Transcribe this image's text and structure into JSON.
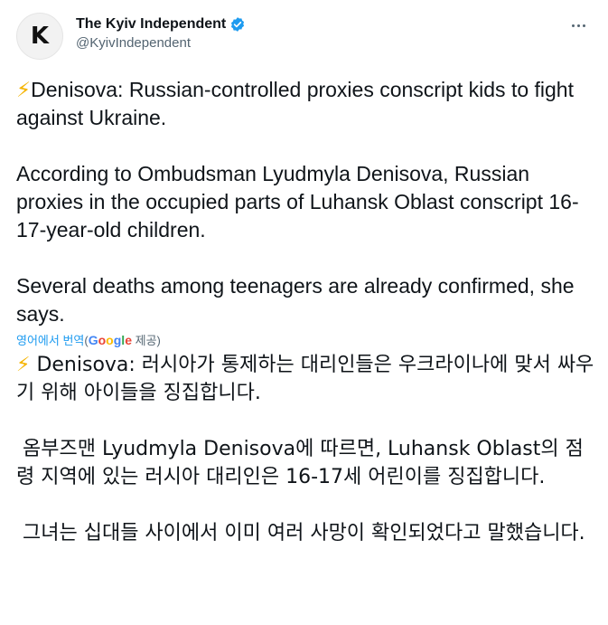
{
  "account": {
    "avatar_letter": "K",
    "display_name": "The Kyiv Independent",
    "handle": "@KyivIndependent",
    "verified": true,
    "verified_color": "#1d9bf0"
  },
  "menu": {
    "icon": "more-horizontal-icon"
  },
  "tweet": {
    "bolt": "⚡",
    "text_after_bolt": "Denisova: Russian-controlled proxies conscript kids to fight against Ukraine.\n\nAccording to Ombudsman Lyudmyla Denisova, Russian proxies in the occupied parts of Luhansk Oblast conscript 16-17-year-old children.\n\nSeveral deaths among teenagers are already confirmed, she says."
  },
  "translation": {
    "link_label": "영어에서 번역",
    "open_paren": "(",
    "google_g1": "G",
    "google_o1": "o",
    "google_o2": "o",
    "google_g2": "g",
    "google_l": "l",
    "google_e": "e",
    "provided_label": "제공)",
    "text_after_bolt": " Denisova: 러시아가 통제하는 대리인들은 우크라이나에 맞서 싸우기 위해 아이들을 징집합니다.\n\n 옴부즈맨 Lyudmyla Denisova에 따르면, Luhansk Oblast의 점령 지역에 있는 러시아 대리인은 16-17세 어린이를 징집합니다.\n\n 그녀는 십대들 사이에서 이미 여러 사망이 확인되었다고 말했습니다."
  }
}
